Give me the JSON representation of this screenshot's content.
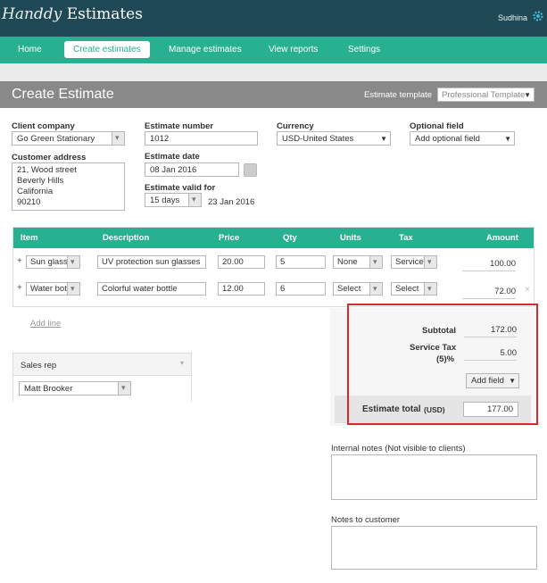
{
  "app": {
    "logo_part1": "Handdy",
    "logo_part2": "Estimates",
    "user": "Sudhina"
  },
  "nav": [
    "Home",
    "Create estimates",
    "Manage estimates",
    "View reports",
    "Settings"
  ],
  "page": {
    "title": "Create Estimate",
    "template_label": "Estimate template",
    "template_value": "Professional Template"
  },
  "form": {
    "client_company_label": "Client company",
    "client_company": "Go Green Stationary",
    "customer_address_label": "Customer address",
    "address": [
      "21, Wood street",
      "Beverly Hills",
      "California",
      "90210"
    ],
    "estimate_number_label": "Estimate number",
    "estimate_number": "1012",
    "estimate_date_label": "Estimate date",
    "estimate_date": "08 Jan 2016",
    "valid_for_label": "Estimate valid for",
    "valid_for": "15 days",
    "valid_until": "23 Jan 2016",
    "currency_label": "Currency",
    "currency": "USD-United States",
    "optional_label": "Optional field",
    "optional_value": "Add optional field"
  },
  "items": {
    "headers": [
      "Item",
      "Description",
      "Price",
      "Qty",
      "Units",
      "Tax",
      "Amount"
    ],
    "rows": [
      {
        "item": "Sun glass",
        "description": "UV protection sun glasses",
        "price": "20.00",
        "qty": "5",
        "units": "None",
        "tax": "Service",
        "amount": "100.00"
      },
      {
        "item": "Water bot",
        "description": "Colorful water bottle",
        "price": "12.00",
        "qty": "6",
        "units": "Select",
        "tax": "Select",
        "amount": "72.00"
      }
    ],
    "add_line": "Add line"
  },
  "sales_rep": {
    "label": "Sales rep",
    "value": "Matt Brooker"
  },
  "totals": {
    "subtotal_label": "Subtotal",
    "subtotal": "172.00",
    "tax_label_1": "Service Tax",
    "tax_label_2": "(5)%",
    "tax": "5.00",
    "add_field": "Add field",
    "total_label": "Estimate total",
    "total_currency": "(USD)",
    "total": "177.00"
  },
  "notes": {
    "internal_label": "Internal notes (Not visible to clients)",
    "customer_label": "Notes to customer"
  },
  "colors": {
    "topbar": "#1f4a55",
    "accent": "#27b190",
    "header": "#898989",
    "highlight": "#d42a2a"
  }
}
